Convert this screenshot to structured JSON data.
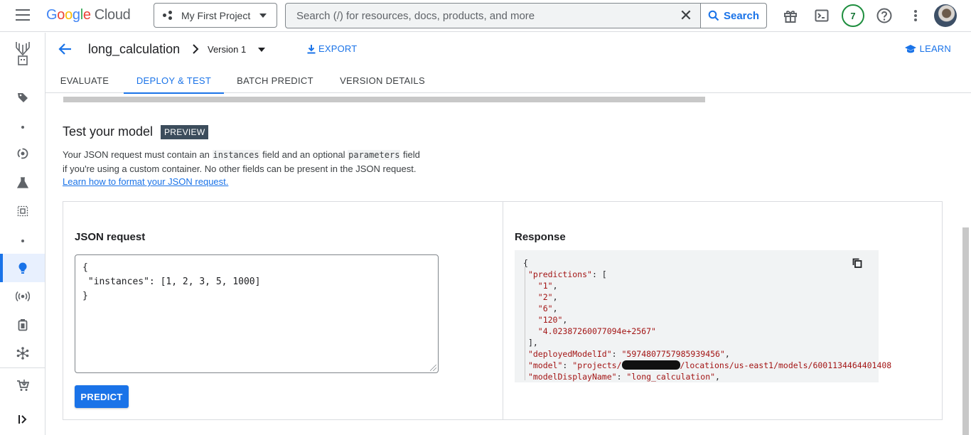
{
  "topbar": {
    "logo_google": [
      "G",
      "o",
      "o",
      "g",
      "l",
      "e"
    ],
    "logo_cloud": "Cloud",
    "project_name": "My First Project",
    "search_placeholder": "Search (/) for resources, docs, products, and more",
    "search_button": "Search",
    "notifications_count": "7"
  },
  "header": {
    "model_name": "long_calculation",
    "version_label": "Version 1",
    "export_label": "EXPORT",
    "learn_label": "LEARN"
  },
  "tabs": [
    {
      "label": "EVALUATE"
    },
    {
      "label": "DEPLOY & TEST",
      "active": true
    },
    {
      "label": "BATCH PREDICT"
    },
    {
      "label": "VERSION DETAILS"
    }
  ],
  "test_section": {
    "title": "Test your model",
    "preview_chip": "PREVIEW",
    "desc_part1": "Your JSON request must contain an ",
    "desc_code1": "instances",
    "desc_part2": " field and an optional ",
    "desc_code2": "parameters",
    "desc_part3": " field",
    "desc_line2": "if you're using a custom container. No other fields can be present in the JSON request.",
    "learn_link": "Learn how to format your JSON request."
  },
  "json_request": {
    "label": "JSON request",
    "value": "{\n \"instances\": [1, 2, 3, 5, 1000]\n}",
    "predict_button": "PREDICT"
  },
  "response": {
    "label": "Response",
    "lines": {
      "l1": "{",
      "l2_key": "\"predictions\"",
      "l2_rest": ": [",
      "l3": "\"1\"",
      "l4": "\"2\"",
      "l5": "\"6\"",
      "l6": "\"120\"",
      "l7": "\"4.02387260077094e+2567\"",
      "l8": "],",
      "l9_key": "\"deployedModelId\"",
      "l9_val": "\"5974807757985939456\"",
      "l10_key": "\"model\"",
      "l10_val_a": "\"projects/",
      "l10_val_b": "/locations/us-east1/models/6001134464401408",
      "l11_key": "\"modelDisplayName\"",
      "l11_val": "\"long_calculation\""
    }
  },
  "colors": {
    "accent": "#1a73e8",
    "badge_green": "#1e8e3e",
    "preview_chip_bg": "#3c4d5c"
  }
}
